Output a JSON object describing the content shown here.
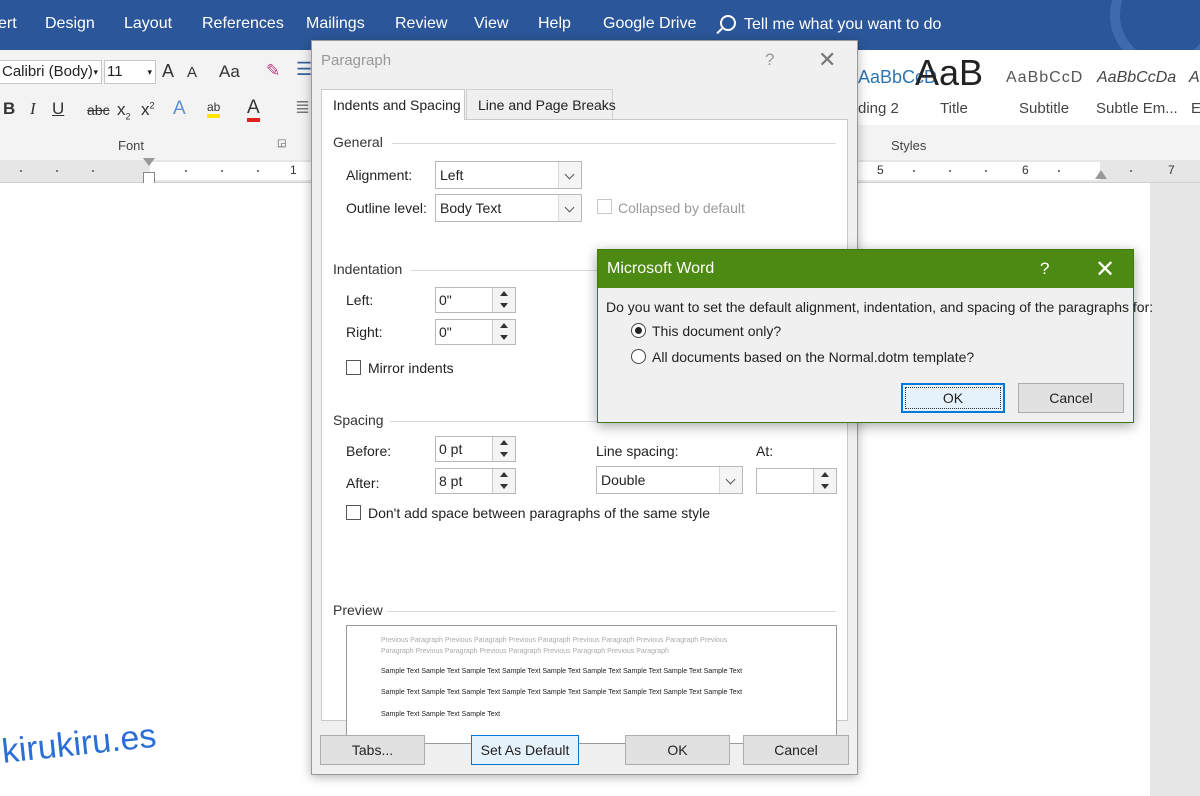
{
  "menu": {
    "tabs": [
      "ert",
      "Design",
      "Layout",
      "References",
      "Mailings",
      "Review",
      "View",
      "Help",
      "Google Drive"
    ],
    "tell_me": "Tell me what you want to do"
  },
  "ribbon": {
    "font_name": "Calibri (Body)",
    "font_size": "11",
    "grow_font": "A",
    "shrink_font": "A",
    "change_case": "Aa",
    "bold": "B",
    "italic": "I",
    "underline": "U",
    "strikethrough": "abc",
    "subscript": "x",
    "superscript": "x",
    "font_color": "A",
    "font_group_label": "Font",
    "styles_group_label": "Styles",
    "styles": [
      {
        "preview": "AaBbCcD",
        "name": "ding 2"
      },
      {
        "preview": "AaB",
        "name": "Title"
      },
      {
        "preview": "AaBbCcD",
        "name": "Subtitle"
      },
      {
        "preview": "AaBbCcDa",
        "name": "Subtle Em..."
      },
      {
        "preview": "A",
        "name": "E"
      }
    ]
  },
  "ruler": {
    "numbers": [
      "1",
      "5",
      "6",
      "7"
    ]
  },
  "paragraph_dialog": {
    "title": "Paragraph",
    "help": "?",
    "close": "✕",
    "tabs": [
      "Indents and Spacing",
      "Line and Page Breaks"
    ],
    "general": {
      "header": "General",
      "alignment_label": "Alignment:",
      "alignment_value": "Left",
      "outline_label": "Outline level:",
      "outline_value": "Body Text",
      "collapsed_label": "Collapsed by default"
    },
    "indentation": {
      "header": "Indentation",
      "left_label": "Left:",
      "left_value": "0\"",
      "right_label": "Right:",
      "right_value": "0\"",
      "mirror_label": "Mirror indents"
    },
    "spacing": {
      "header": "Spacing",
      "before_label": "Before:",
      "before_value": "0 pt",
      "after_label": "After:",
      "after_value": "8 pt",
      "line_spacing_label": "Line spacing:",
      "line_spacing_value": "Double",
      "at_label": "At:",
      "at_value": "",
      "dont_add_label": "Don't add space between paragraphs of the same style"
    },
    "preview": {
      "header": "Preview",
      "prev_line1": "Previous Paragraph Previous Paragraph Previous Paragraph Previous Paragraph Previous Paragraph Previous",
      "prev_line2": "Paragraph Previous Paragraph Previous Paragraph Previous Paragraph Previous Paragraph",
      "sample_line1": "Sample Text Sample Text Sample Text Sample Text Sample Text Sample Text Sample Text Sample Text Sample Text",
      "sample_line2": "Sample Text Sample Text Sample Text Sample Text Sample Text Sample Text Sample Text Sample Text Sample Text",
      "sample_line3": "Sample Text Sample Text Sample Text"
    },
    "buttons": {
      "tabs": "Tabs...",
      "set_default": "Set As Default",
      "ok": "OK",
      "cancel": "Cancel"
    }
  },
  "msgbox": {
    "title": "Microsoft Word",
    "help": "?",
    "close": "✕",
    "question": "Do you want to set the default alignment, indentation, and spacing of the paragraphs for:",
    "option1": "This document only?",
    "option2": "All documents based on the Normal.dotm template?",
    "ok": "OK",
    "cancel": "Cancel"
  },
  "watermark": "kirukiru.es",
  "colors": {
    "ribbon_blue": "#2b579a",
    "msgbox_green": "#4d8a14",
    "accent_blue": "#0078d7"
  }
}
